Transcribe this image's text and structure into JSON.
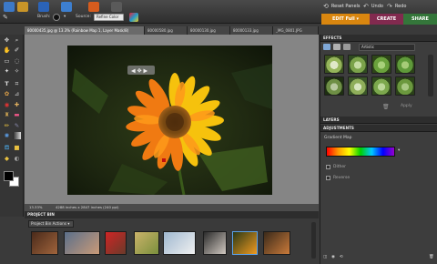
{
  "topbar": {
    "brush_label": "Brush:",
    "source_label": "Source:",
    "source_value": "Refine Color",
    "reset_panels": "Reset Panels",
    "undo": "Undo",
    "redo": "Redo"
  },
  "modes": [
    {
      "label": "EDIT Full",
      "color": "#d9860f"
    },
    {
      "label": "CREATE",
      "color": "#822a4f"
    },
    {
      "label": "SHARE",
      "color": "#34763a"
    }
  ],
  "tabs": [
    "80000435.jpg @ 13.3% (Rainbow Map 1, Layer Mask/8)",
    "80000580.jpg",
    "80000130.jpg",
    "80000133.jpg",
    "_MG_0801.JPG"
  ],
  "status": {
    "zoom": "13.33%",
    "doc_info": "4288 inches x 2847 inches (240 ppi)"
  },
  "effects": {
    "title": "EFFECTS",
    "dropdown": "Artistic",
    "apply": "Apply",
    "swatches": [
      "#95b55a",
      "#7ba24a",
      "#6aa23c",
      "#5f9a3a",
      "#6e8f45",
      "#8fae5a",
      "#7ca84d",
      "#6b983e"
    ]
  },
  "layers": {
    "title": "LAYERS"
  },
  "adjustments": {
    "title": "ADJUSTMENTS",
    "subtitle": "Gradient Map",
    "gradient_colors": [
      "#ff0000",
      "#ff9900",
      "#ffff00",
      "#00d000",
      "#00c8ff",
      "#0000ff",
      "#9900cc"
    ],
    "option_dither": "Dither",
    "option_reverse": "Reverse"
  },
  "bin": {
    "title": "PROJECT BIN",
    "dropdown": "Project Bin Actions",
    "thumbs": [
      {
        "name": "photo-1",
        "colors": [
          "#4a2a1a",
          "#a0643c"
        ]
      },
      {
        "name": "photo-2",
        "colors": [
          "#5b6f8a",
          "#c99a78"
        ]
      },
      {
        "name": "photo-3",
        "colors": [
          "#d02525",
          "#6a3a2a"
        ]
      },
      {
        "name": "photo-4",
        "colors": [
          "#cbb36a",
          "#7a8f3c"
        ]
      },
      {
        "name": "photo-5",
        "colors": [
          "#9fb8d0",
          "#f0f0f0"
        ]
      },
      {
        "name": "photo-6",
        "colors": [
          "#2b2b2b",
          "#d0c8c0"
        ]
      },
      {
        "name": "photo-7",
        "colors": [
          "#2a3816",
          "#f09a20"
        ]
      },
      {
        "name": "photo-8",
        "colors": [
          "#3a2a1a",
          "#c97a3a"
        ]
      }
    ]
  }
}
